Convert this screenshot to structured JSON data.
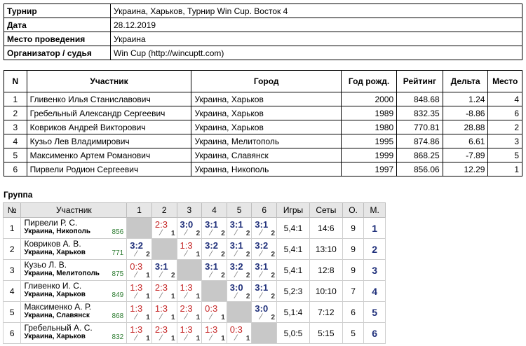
{
  "info": [
    {
      "key": "Турнир",
      "value": "Украина, Харьков, Турнир Win Cup. Восток 4"
    },
    {
      "key": "Дата",
      "value": "28.12.2019"
    },
    {
      "key": "Место проведения",
      "value": "Украина"
    },
    {
      "key": "Организатор / судья",
      "value": "Win Cup (http://wincuptt.com)"
    }
  ],
  "players_table": {
    "headers": [
      "N",
      "Участник",
      "Город",
      "Год рожд.",
      "Рейтинг",
      "Дельта",
      "Место"
    ],
    "rows": [
      [
        "1",
        "Гливенко Илья Станиславович",
        "Украина, Харьков",
        "2000",
        "848.68",
        "1.24",
        "4"
      ],
      [
        "2",
        "Гребельный Александр Сергеевич",
        "Украина, Харьков",
        "1989",
        "832.35",
        "-8.86",
        "6"
      ],
      [
        "3",
        "Ковриков Андрей Викторович",
        "Украина, Харьков",
        "1980",
        "770.81",
        "28.88",
        "2"
      ],
      [
        "4",
        "Кузьо Лев Владимирович",
        "Украина, Мелитополь",
        "1995",
        "874.86",
        "6.61",
        "3"
      ],
      [
        "5",
        "Максименко Артем Романович",
        "Украина, Славянск",
        "1999",
        "868.25",
        "-7.89",
        "5"
      ],
      [
        "6",
        "Пирвели Родион Сергеевич",
        "Украина, Никополь",
        "1997",
        "856.06",
        "12.29",
        "1"
      ]
    ]
  },
  "group": {
    "title": "Группа",
    "headers": [
      "№",
      "Участник",
      "1",
      "2",
      "3",
      "4",
      "5",
      "6",
      "Игры",
      "Сеты",
      "О.",
      "М."
    ],
    "rows": [
      {
        "n": "1",
        "name": "Пирвели Р. С.",
        "city": "Украина, Никополь",
        "rating": "856",
        "cells": [
          null,
          [
            "2:3",
            "1"
          ],
          [
            "3:0",
            "2"
          ],
          [
            "3:1",
            "2"
          ],
          [
            "3:1",
            "2"
          ],
          [
            "3:1",
            "2"
          ]
        ],
        "games": "5,4:1",
        "sets": "14:6",
        "points": "9",
        "place": "1"
      },
      {
        "n": "2",
        "name": "Ковриков А. В.",
        "city": "Украина, Харьков",
        "rating": "771",
        "cells": [
          [
            "3:2",
            "2"
          ],
          null,
          [
            "1:3",
            "1"
          ],
          [
            "3:2",
            "2"
          ],
          [
            "3:1",
            "2"
          ],
          [
            "3:2",
            "2"
          ]
        ],
        "games": "5,4:1",
        "sets": "13:10",
        "points": "9",
        "place": "2"
      },
      {
        "n": "3",
        "name": "Кузьо Л. В.",
        "city": "Украина, Мелитополь",
        "rating": "875",
        "cells": [
          [
            "0:3",
            "1"
          ],
          [
            "3:1",
            "2"
          ],
          null,
          [
            "3:1",
            "2"
          ],
          [
            "3:2",
            "2"
          ],
          [
            "3:1",
            "2"
          ]
        ],
        "games": "5,4:1",
        "sets": "12:8",
        "points": "9",
        "place": "3"
      },
      {
        "n": "4",
        "name": "Гливенко И. С.",
        "city": "Украина, Харьков",
        "rating": "849",
        "cells": [
          [
            "1:3",
            "1"
          ],
          [
            "2:3",
            "1"
          ],
          [
            "1:3",
            "1"
          ],
          null,
          [
            "3:0",
            "2"
          ],
          [
            "3:1",
            "2"
          ]
        ],
        "games": "5,2:3",
        "sets": "10:10",
        "points": "7",
        "place": "4"
      },
      {
        "n": "5",
        "name": "Максименко А. Р.",
        "city": "Украина, Славянск",
        "rating": "868",
        "cells": [
          [
            "1:3",
            "1"
          ],
          [
            "1:3",
            "1"
          ],
          [
            "2:3",
            "1"
          ],
          [
            "0:3",
            "1"
          ],
          null,
          [
            "3:0",
            "2"
          ]
        ],
        "games": "5,1:4",
        "sets": "7:12",
        "points": "6",
        "place": "5"
      },
      {
        "n": "6",
        "name": "Гребельный А. С.",
        "city": "Украина, Харьков",
        "rating": "832",
        "cells": [
          [
            "1:3",
            "1"
          ],
          [
            "2:3",
            "1"
          ],
          [
            "1:3",
            "1"
          ],
          [
            "1:3",
            "1"
          ],
          [
            "0:3",
            "1"
          ],
          null
        ],
        "games": "5,0:5",
        "sets": "5:15",
        "points": "5",
        "place": "6"
      }
    ]
  }
}
